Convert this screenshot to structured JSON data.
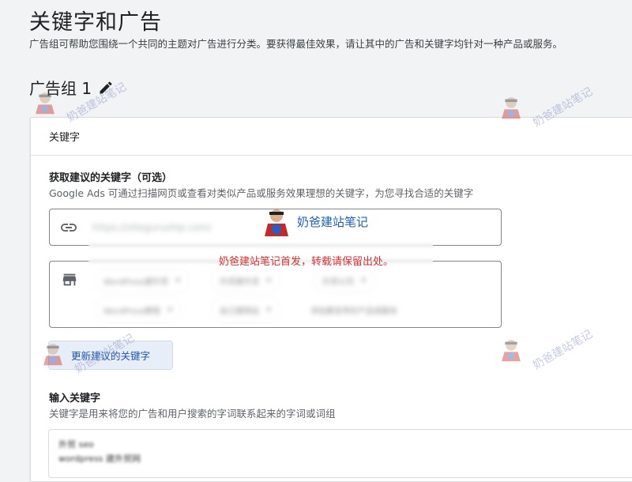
{
  "header": {
    "title": "关键字和广告",
    "subtitle": "广告组可帮助您围绕一个共同的主题对广告进行分类。要获得最佳效果，请让其中的广告和关键字均针对一种产品或服务。"
  },
  "ad_group": {
    "title": "广告组 1",
    "edit_icon": "pencil-icon"
  },
  "card": {
    "header": "关键字",
    "suggest_section": {
      "title": "获取建议的关键字（可选）",
      "description": "Google Ads 可通过扫描网页或查看对类似产品或服务效果理想的关键字，为您寻找合适的关键字",
      "url_icon": "link-icon",
      "url_value": "https://siteguruship.com/",
      "product_icon": "storefront-icon",
      "chips": [
        "WordPress建外贸",
        "外贸建外贸",
        "外贸公司",
        "WordPress教程",
        "自己建网站",
        "添加要宣传的产品或服务"
      ],
      "refresh_button": "更新建议的关键字"
    },
    "keywords_section": {
      "title": "输入关键字",
      "description": "关键字是用来将您的广告和用户搜索的字词联系起来的字词或词组",
      "lines": [
        "外贸 seo",
        "wordpress 建外贸网"
      ]
    }
  },
  "watermark": {
    "brand": "奶爸建站笔记",
    "notice": "奶爸建站笔记首发，转载请保留出处。"
  },
  "colors": {
    "background": "#f1f3f4",
    "primary_blue": "#1a55b8",
    "notice_red": "#e03030"
  }
}
